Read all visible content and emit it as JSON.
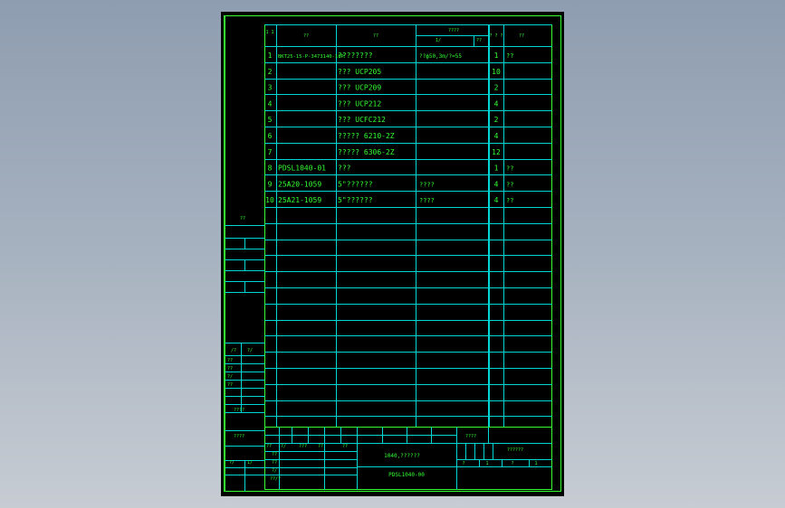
{
  "header": {
    "seq": "1\n1",
    "code": "??",
    "name": "??",
    "material_group": "????",
    "material_sub": "1/",
    "material_sub2": "??",
    "qty": "?\n?\n?",
    "remark": "??"
  },
  "rows": [
    {
      "seq": "1",
      "code": "BKT25-15-P-3473140-10P",
      "name": "????????",
      "material": "??ф50,3m/?=55",
      "qty": "1",
      "remark": "??"
    },
    {
      "seq": "2",
      "code": "",
      "name": "??? UCP205",
      "material": "",
      "qty": "10",
      "remark": ""
    },
    {
      "seq": "3",
      "code": "",
      "name": "??? UCP209",
      "material": "",
      "qty": "2",
      "remark": ""
    },
    {
      "seq": "4",
      "code": "",
      "name": "??? UCP212",
      "material": "",
      "qty": "4",
      "remark": ""
    },
    {
      "seq": "5",
      "code": "",
      "name": "??? UCFC212",
      "material": "",
      "qty": "2",
      "remark": ""
    },
    {
      "seq": "6",
      "code": "",
      "name": "????? 6210-2Z",
      "material": "",
      "qty": "4",
      "remark": ""
    },
    {
      "seq": "7",
      "code": "",
      "name": "????? 6306-2Z",
      "material": "",
      "qty": "12",
      "remark": ""
    },
    {
      "seq": "8",
      "code": "PDSL1040-01",
      "name": "???",
      "material": "",
      "qty": "1",
      "remark": "??"
    },
    {
      "seq": "9",
      "code": "25A20-1059",
      "name": "5\"??????",
      "material": "????",
      "qty": "4",
      "remark": "??"
    },
    {
      "seq": "10",
      "code": "25A21-1059",
      "name": "5\"??????",
      "material": "????",
      "qty": "4",
      "remark": "??"
    }
  ],
  "left_panel": {
    "top_label": "??",
    "a": "/?",
    "b": "?/",
    "c": "??",
    "d": "??",
    "e": "?/",
    "f": "??",
    "g": "????",
    "h": "????",
    "i": "?/",
    "j": "1/"
  },
  "title_block": {
    "labels_row1": [
      "??",
      "?/",
      "???",
      "??",
      "??"
    ],
    "label_a": "??",
    "label_b": "??",
    "label_c": "?/",
    "label_d": "??/?",
    "title": "1040,??????",
    "drawing_no": "PDSL1040-00",
    "stage": "????",
    "company": "??????",
    "scale_items": [
      "?",
      "1",
      "?",
      "1"
    ]
  },
  "colors": {
    "line": "#00d6d6",
    "frame": "#33ff33",
    "text": "#33ff33"
  }
}
